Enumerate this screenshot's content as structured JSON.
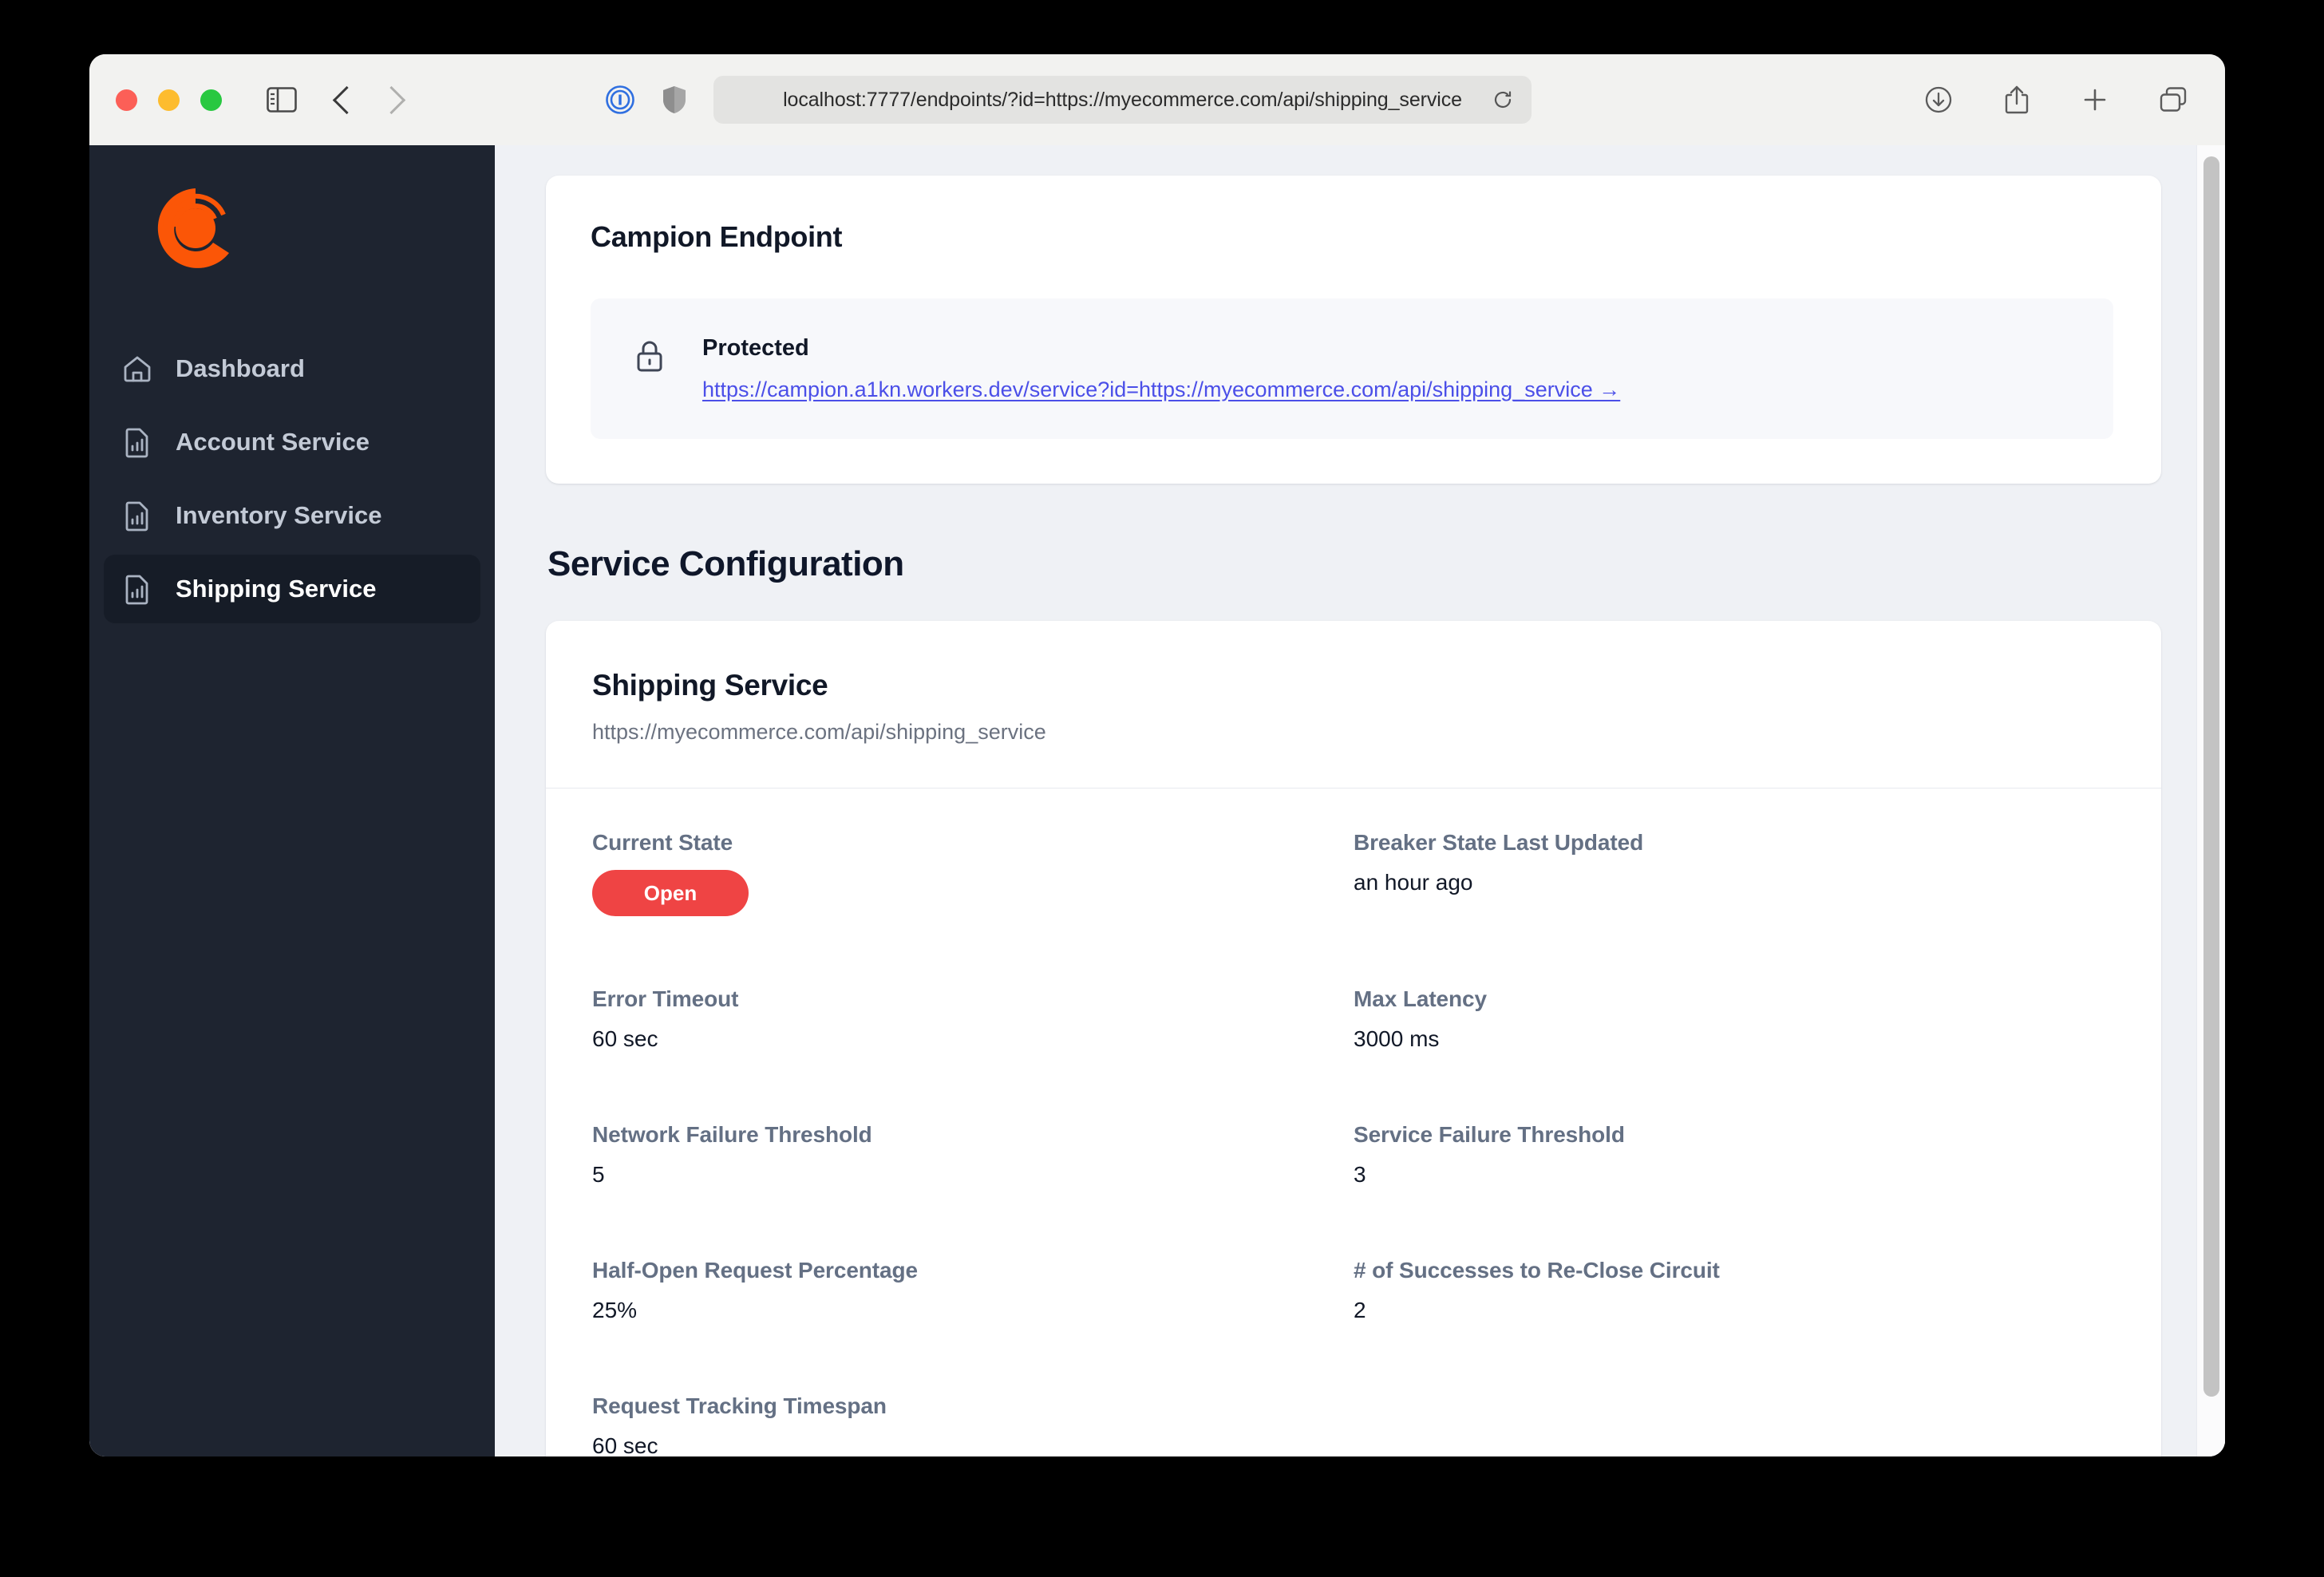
{
  "browser": {
    "url": "localhost:7777/endpoints/?id=https://myecommerce.com/api/shipping_service",
    "traffic_lights": [
      "close",
      "minimize",
      "maximize"
    ],
    "left_icons": [
      "sidebar-toggle-icon",
      "back-icon",
      "forward-icon"
    ],
    "address_icons": [
      "reader-mode-icon",
      "privacy-shield-icon",
      "reload-icon"
    ],
    "right_icons": [
      "downloads-icon",
      "share-icon",
      "new-tab-icon",
      "tab-overview-icon"
    ]
  },
  "sidebar": {
    "logo": "campion-logo",
    "items": [
      {
        "label": "Dashboard",
        "icon": "home-icon",
        "active": false
      },
      {
        "label": "Account Service",
        "icon": "report-icon",
        "active": false
      },
      {
        "label": "Inventory Service",
        "icon": "report-icon",
        "active": false
      },
      {
        "label": "Shipping Service",
        "icon": "report-icon",
        "active": true
      }
    ]
  },
  "endpoint_card": {
    "title": "Campion Endpoint",
    "status_label": "Protected",
    "lock_icon": "lock-icon",
    "link": "https://campion.a1kn.workers.dev/service?id=https://myecommerce.com/api/shipping_service →"
  },
  "service_section": {
    "heading": "Service Configuration",
    "name": "Shipping Service",
    "url": "https://myecommerce.com/api/shipping_service",
    "fields": [
      {
        "label": "Current State",
        "value": "Open",
        "type": "badge"
      },
      {
        "label": "Breaker State Last Updated",
        "value": "an hour ago",
        "type": "text"
      },
      {
        "label": "Error Timeout",
        "value": "60 sec",
        "type": "text"
      },
      {
        "label": "Max Latency",
        "value": "3000 ms",
        "type": "text"
      },
      {
        "label": "Network Failure Threshold",
        "value": "5",
        "type": "text"
      },
      {
        "label": "Service Failure Threshold",
        "value": "3",
        "type": "text"
      },
      {
        "label": "Half-Open Request Percentage",
        "value": "25%",
        "type": "text"
      },
      {
        "label": "# of Successes to Re-Close Circuit",
        "value": "2",
        "type": "text"
      },
      {
        "label": "Request Tracking Timespan",
        "value": "60 sec",
        "type": "text"
      }
    ]
  },
  "colors": {
    "brand_orange": "#fb5607",
    "sidebar_bg": "#1e2430",
    "state_open_red": "#ef4444",
    "link_blue": "#4b4fe8",
    "page_bg": "#eff1f5"
  }
}
